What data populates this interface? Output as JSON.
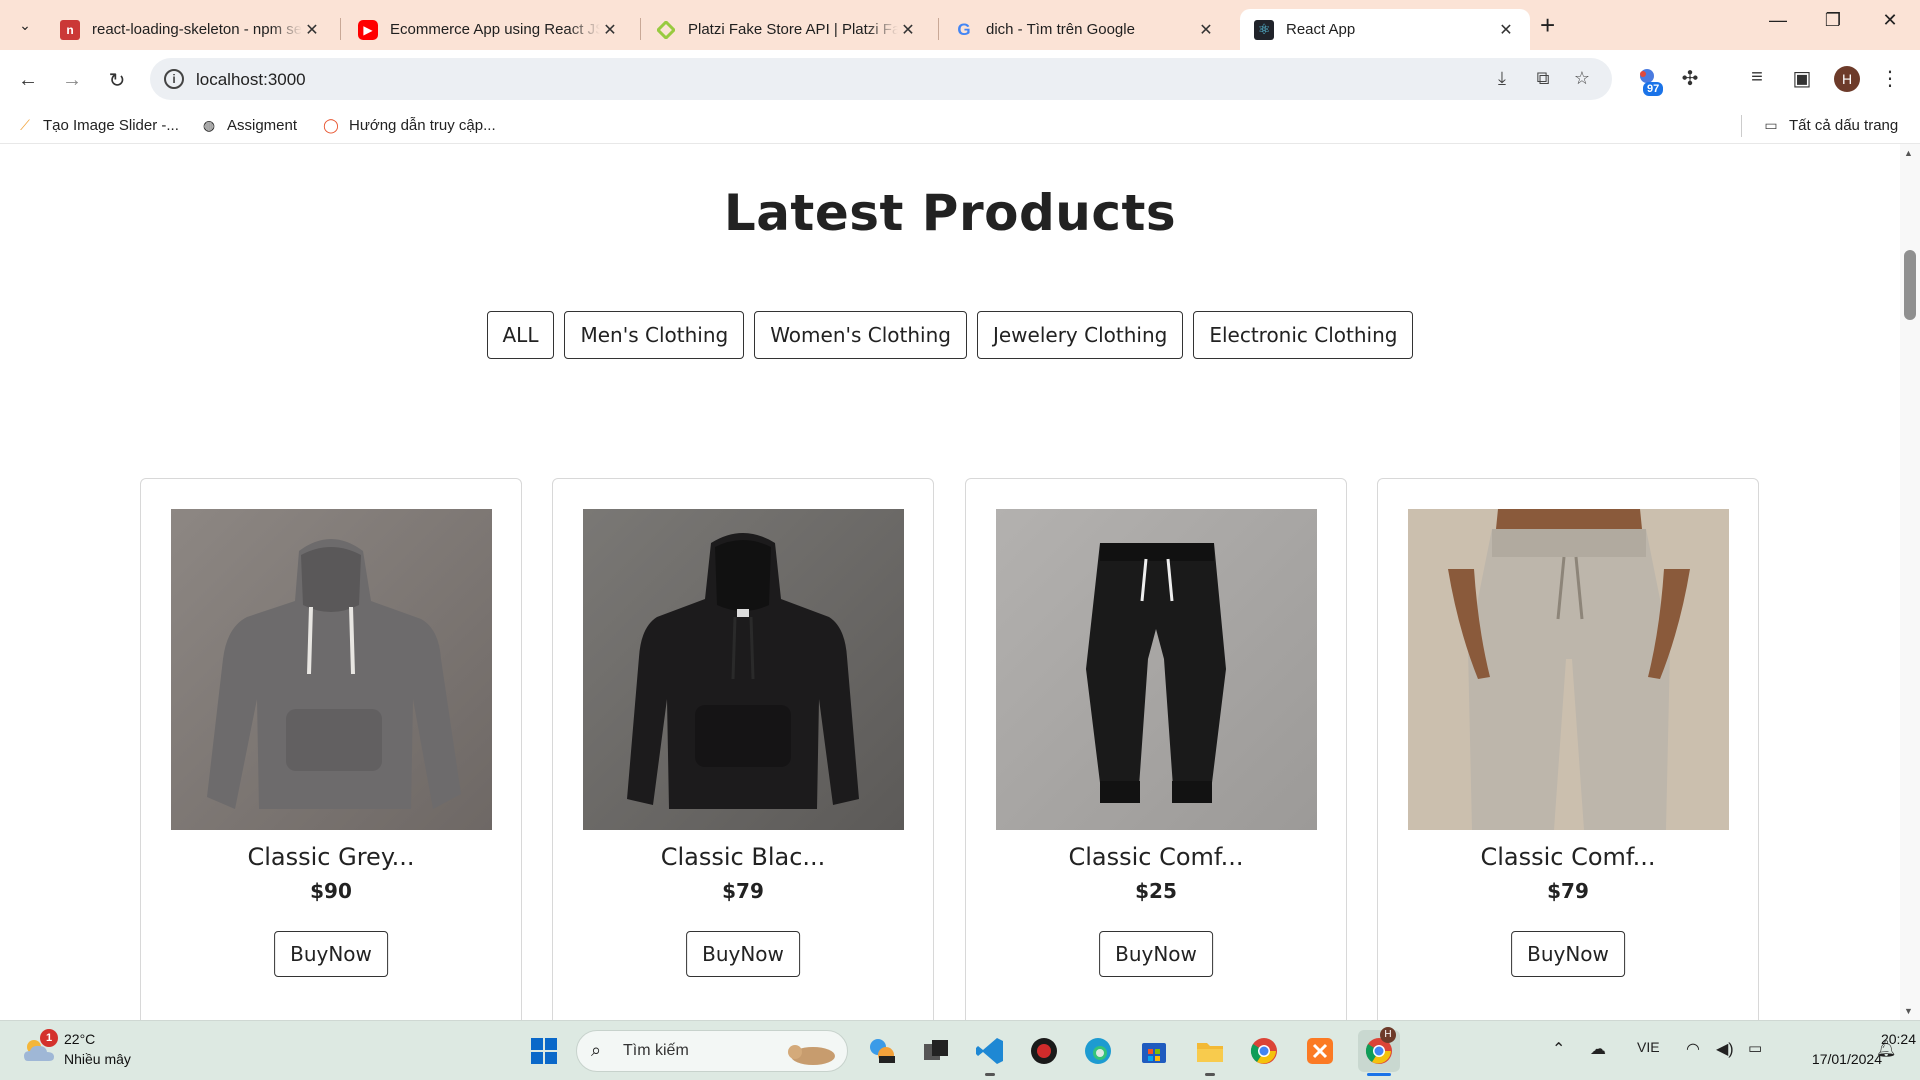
{
  "browser": {
    "tabs": [
      {
        "title": "react-loading-skeleton - npm search",
        "favicon": "npm-icon"
      },
      {
        "title": "Ecommerce App using React JS",
        "favicon": "youtube-icon"
      },
      {
        "title": "Platzi Fake Store API | Platzi Fake",
        "favicon": "platzi-icon"
      },
      {
        "title": "dich - Tìm trên Google",
        "favicon": "google-icon"
      },
      {
        "title": "React App",
        "favicon": "react-icon"
      }
    ],
    "address": "localhost:3000",
    "extension_badge": "97",
    "profile_initial": "H",
    "bookmarks": [
      {
        "label": "Tạo Image Slider -..."
      },
      {
        "label": "Assigment"
      },
      {
        "label": "Hướng dẫn truy cập..."
      }
    ],
    "all_bookmarks_label": "Tất cả dấu trang"
  },
  "page": {
    "title": "Latest Products",
    "filters": [
      "ALL",
      "Men's Clothing",
      "Women's Clothing",
      "Jewelery Clothing",
      "Electronic Clothing"
    ],
    "products": [
      {
        "name": "Classic Grey...",
        "price": "$90",
        "buy_label": "BuyNow",
        "image": "grey-hoodie"
      },
      {
        "name": "Classic Blac...",
        "price": "$79",
        "buy_label": "BuyNow",
        "image": "black-hoodie"
      },
      {
        "name": "Classic Comf...",
        "price": "$25",
        "buy_label": "BuyNow",
        "image": "black-joggers"
      },
      {
        "name": "Classic Comf...",
        "price": "$79",
        "buy_label": "BuyNow",
        "image": "beige-sweatpants"
      }
    ]
  },
  "taskbar": {
    "weather_temp": "22°C",
    "weather_desc": "Nhiều mây",
    "weather_badge": "1",
    "search_placeholder": "Tìm kiếm",
    "language": "VIE",
    "time": "20:24",
    "date": "17/01/2024",
    "chrome_badge": "H"
  },
  "colors": {
    "tabstrip": "#fbe3d6",
    "omnibox": "#eceff3",
    "taskbar": "#dde9e2",
    "text": "#222222"
  }
}
